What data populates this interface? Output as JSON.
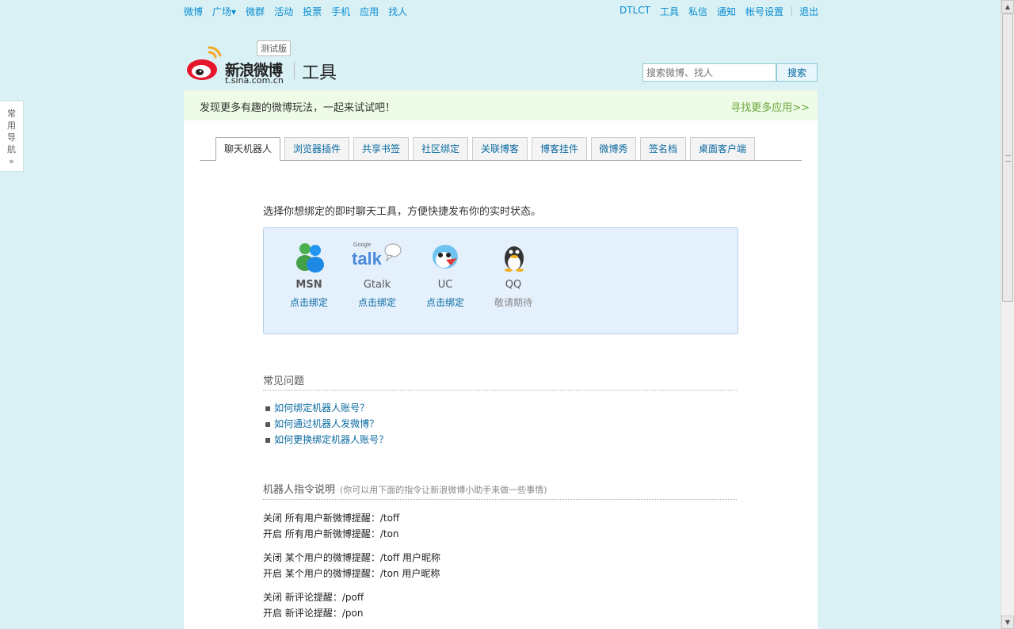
{
  "topnav": {
    "left": [
      "微博",
      "广场",
      "微群",
      "活动",
      "投票",
      "手机",
      "应用",
      "找人"
    ],
    "square_caret": "▾",
    "right": [
      "DTLCT",
      "工具",
      "私信",
      "通知",
      "帐号设置"
    ],
    "logout": "退出"
  },
  "header": {
    "beta": "测试版",
    "brand": "新浪微博",
    "domain": "t.sina.com.cn",
    "title": "工具",
    "search_placeholder": "搜索微博、找人",
    "search_button": "搜索"
  },
  "sidetab": {
    "label_lines": [
      "常",
      "用",
      "导",
      "航",
      "»"
    ]
  },
  "banner": {
    "message": "发现更多有趣的微博玩法，一起来试试吧！",
    "more": "寻找更多应用>>"
  },
  "tabs": [
    {
      "label": "聊天机器人",
      "active": true
    },
    {
      "label": "浏览器插件"
    },
    {
      "label": "共享书签"
    },
    {
      "label": "社区绑定"
    },
    {
      "label": "关联博客"
    },
    {
      "label": "博客挂件"
    },
    {
      "label": "微博秀"
    },
    {
      "label": "签名档"
    },
    {
      "label": "桌面客户端"
    }
  ],
  "intro": "选择你想绑定的即时聊天工具，方便快捷发布你的实时状态。",
  "im_tools": [
    {
      "name": "MSN",
      "action": "点击绑定",
      "icon": "msn-icon"
    },
    {
      "name": "Gtalk",
      "action": "点击绑定",
      "icon": "gtalk-icon"
    },
    {
      "name": "UC",
      "action": "点击绑定",
      "icon": "uc-icon"
    },
    {
      "name": "QQ",
      "action": "敬请期待",
      "icon": "qq-icon"
    }
  ],
  "gtalk_logo_text": {
    "google": "Google",
    "talk": "talk"
  },
  "faq": {
    "title": "常见问题",
    "bullet": "▪",
    "items": [
      "如何绑定机器人账号？",
      "如何通过机器人发微博？",
      "如何更换绑定机器人账号？"
    ]
  },
  "commands": {
    "title": "机器人指令说明",
    "note": "(你可以用下面的指令让新浪微博小助手来做一些事情)",
    "rows": [
      "关闭 所有用户新微博提醒：/toff",
      "开启 所有用户新微博提醒：/ton",
      "关闭 某个用户的微博提醒：/toff 用户昵称",
      "开启 某个用户的微博提醒：/ton 用户昵称",
      "关闭 新评论提醒：/poff",
      "开启 新评论提醒：/pon"
    ]
  },
  "colors": {
    "link": "#0a8cd2",
    "banner_more": "#6aa53a",
    "im_box": "#e5f0fd"
  },
  "scrollbar": {
    "up": "▲",
    "down": "▼"
  }
}
